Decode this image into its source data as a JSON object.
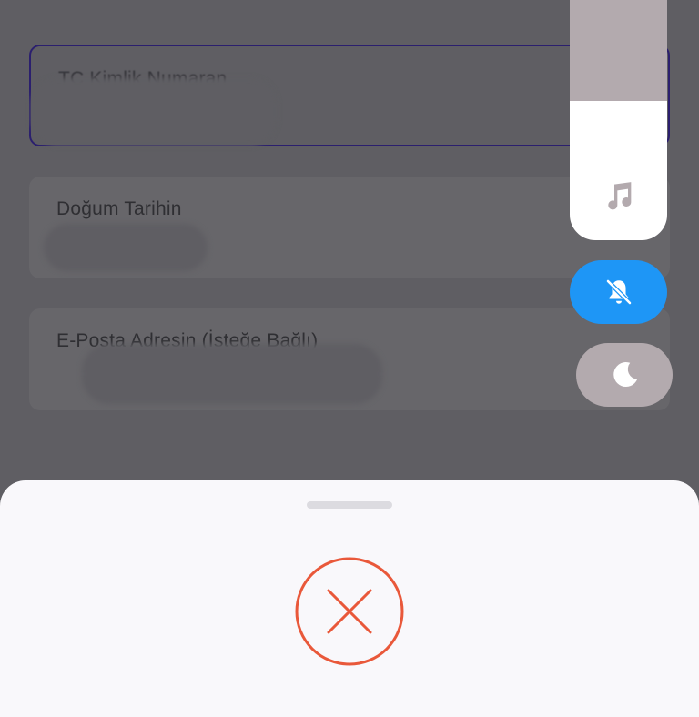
{
  "form": {
    "fields": [
      {
        "label": "TC Kimlik Numaran",
        "value": "",
        "state": "focused"
      },
      {
        "label": "Doğum Tarihin",
        "value": ""
      },
      {
        "label": "E-Posta Adresin (İsteğe Bağlı)",
        "value": ""
      }
    ]
  },
  "volume_panel": {
    "level": 0.58,
    "stream": "music",
    "icons": {
      "slider": "music-note-icon",
      "mute": "bell-off-icon",
      "dnd": "moon-icon"
    },
    "mute_active": true,
    "dnd_active": false
  },
  "bottom_sheet": {
    "status": "error",
    "icon": "error-x-icon"
  },
  "colors": {
    "accent_blue": "#1e96f6",
    "error_orange": "#e9583a",
    "focus_border": "#2b1f6e",
    "sheet_bg": "#f9f8fb",
    "overlay_bg": "#5f5e63"
  }
}
